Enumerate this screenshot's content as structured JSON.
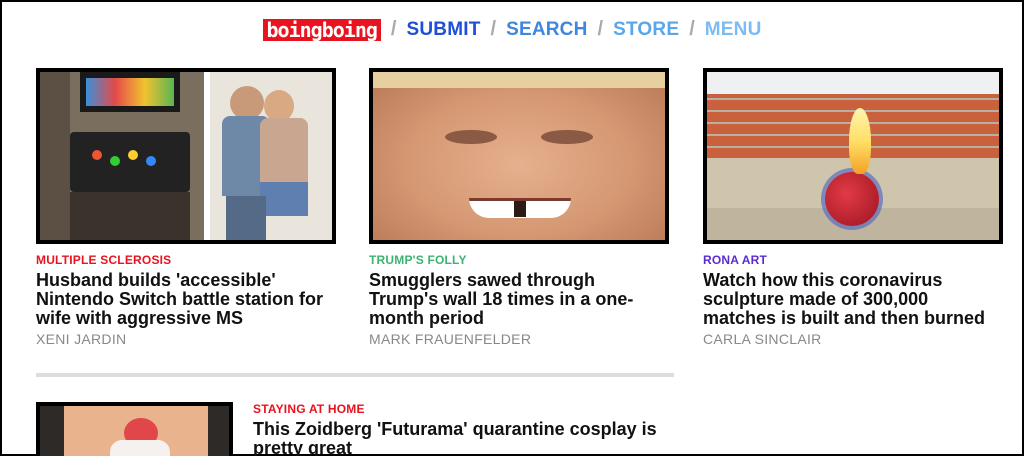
{
  "header": {
    "logo": "boingboing",
    "nav": [
      {
        "label": "SUBMIT",
        "color": "#1f4fd6"
      },
      {
        "label": "SEARCH",
        "color": "#3f86e0"
      },
      {
        "label": "STORE",
        "color": "#5aa6e8"
      },
      {
        "label": "MENU",
        "color": "#7dbbf0"
      }
    ],
    "separator": "/"
  },
  "posts": [
    {
      "category": "MULTIPLE SCLEROSIS",
      "category_color": "#e8131f",
      "title": "Husband builds 'accessible' Nintendo Switch battle station for wife with aggressive MS",
      "author": "XENI JARDIN"
    },
    {
      "category": "TRUMP'S FOLLY",
      "category_color": "#3cb371",
      "title": "Smugglers sawed through Trump's wall 18 times in a one-month period",
      "author": "MARK FRAUENFELDER"
    },
    {
      "category": "RONA ART",
      "category_color": "#5b2bd0",
      "title": "Watch how this coronavirus sculpture made of 300,000 matches is built and then burned",
      "author": "CARLA SINCLAIR"
    },
    {
      "category": "STAYING AT HOME",
      "category_color": "#e8131f",
      "title": "This Zoidberg 'Futurama' quarantine cosplay is pretty great",
      "author": ""
    }
  ]
}
